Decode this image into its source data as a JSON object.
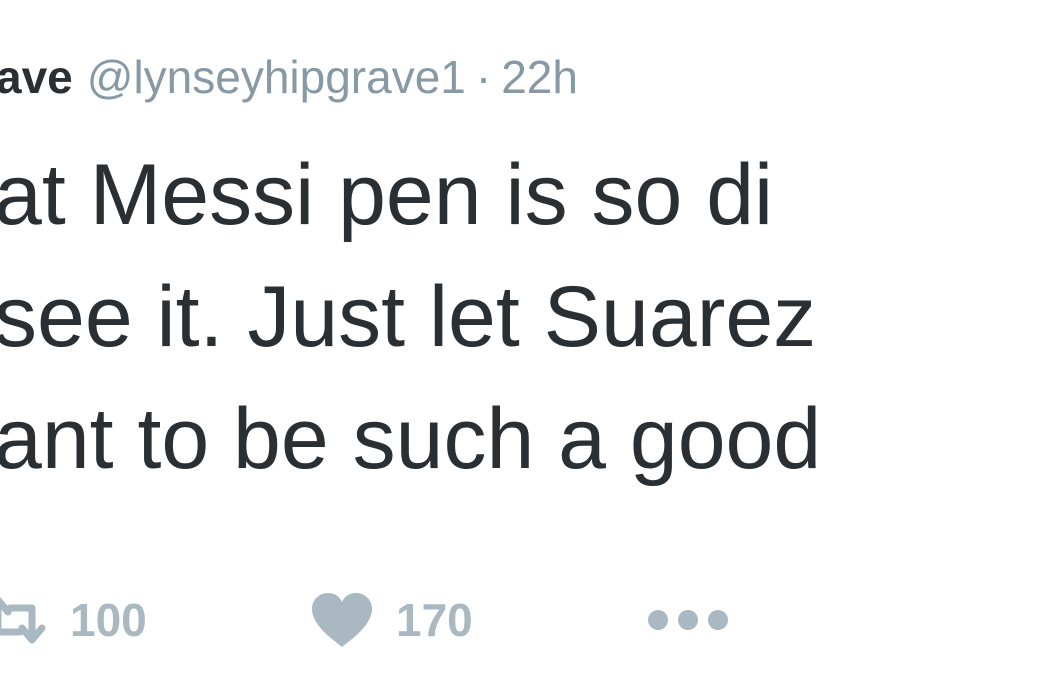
{
  "tweet": {
    "display_name": "ave",
    "handle": "@lynseyhipgrave1",
    "separator": "·",
    "time": "22h",
    "lines": [
      "at Messi pen is so di",
      "see it. Just let Suarez",
      "ant to be such a good"
    ]
  },
  "actions": {
    "retweet_count": "100",
    "like_count": "170"
  },
  "icons": {
    "retweet": "retweet-icon",
    "like": "heart-icon",
    "more": "more-dots-icon"
  },
  "colors": {
    "text": "#292f33",
    "muted": "#8899a6",
    "action": "#aab8c2"
  }
}
